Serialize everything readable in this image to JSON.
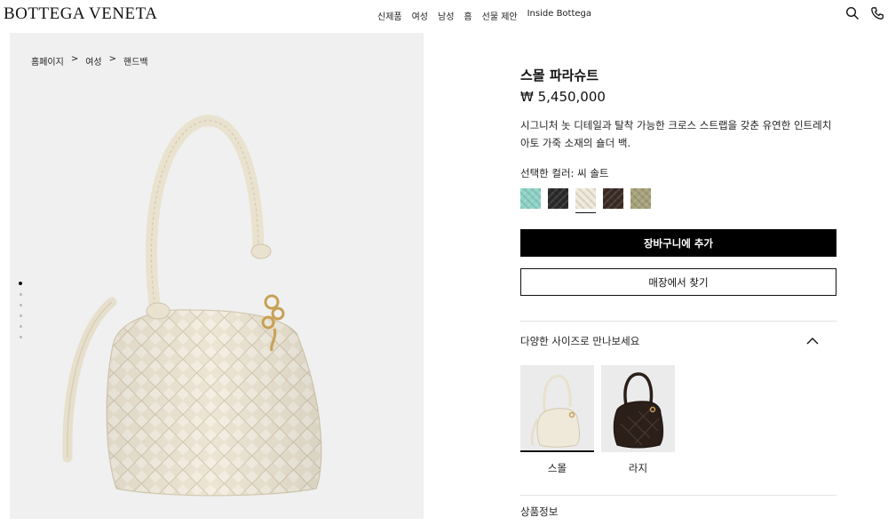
{
  "header": {
    "logo": "BOTTEGA VENETA",
    "nav": [
      "신제품",
      "여성",
      "남성",
      "홈",
      "선물 제안",
      "Inside Bottega"
    ],
    "icons": [
      "search-icon",
      "phone-icon"
    ]
  },
  "breadcrumb": {
    "items": [
      "홈페이지",
      "여성",
      "핸드백"
    ],
    "separator": ">"
  },
  "gallery": {
    "total_images": 6,
    "active_index": 0
  },
  "product": {
    "name": "스몰 파라슈트",
    "price": "₩ 5,450,000",
    "description": "시그니처 놋 디테일과 탈착 가능한 크로스 스트랩을 갖춘 유연한 인트레치아토 가죽 소재의 숄더 백.",
    "color_label": "선택한 컬러: 씨 솔트",
    "swatches": [
      {
        "name": "mint",
        "color": "#8fd3c6",
        "selected": false
      },
      {
        "name": "black",
        "color": "#2a2a2a",
        "selected": false
      },
      {
        "name": "sea-salt",
        "color": "#efe9da",
        "selected": true
      },
      {
        "name": "dark-brown",
        "color": "#3a2a24",
        "selected": false
      },
      {
        "name": "olive",
        "color": "#a7a27a",
        "selected": false
      }
    ],
    "add_to_cart": "장바구니에 추가",
    "find_in_store": "매장에서 찾기"
  },
  "sizes": {
    "heading": "다양한 사이즈로 만나보세요",
    "expanded": true,
    "options": [
      {
        "label": "스몰",
        "selected": true,
        "bag_color": "#efe9da"
      },
      {
        "label": "라지",
        "selected": false,
        "bag_color": "#2b1f1a"
      }
    ]
  },
  "next_section": {
    "label": "상품정보"
  },
  "colors": {
    "accent": "#000000",
    "bag_cream": "#efe9da",
    "gallery_bg": "#f0f0f0"
  }
}
